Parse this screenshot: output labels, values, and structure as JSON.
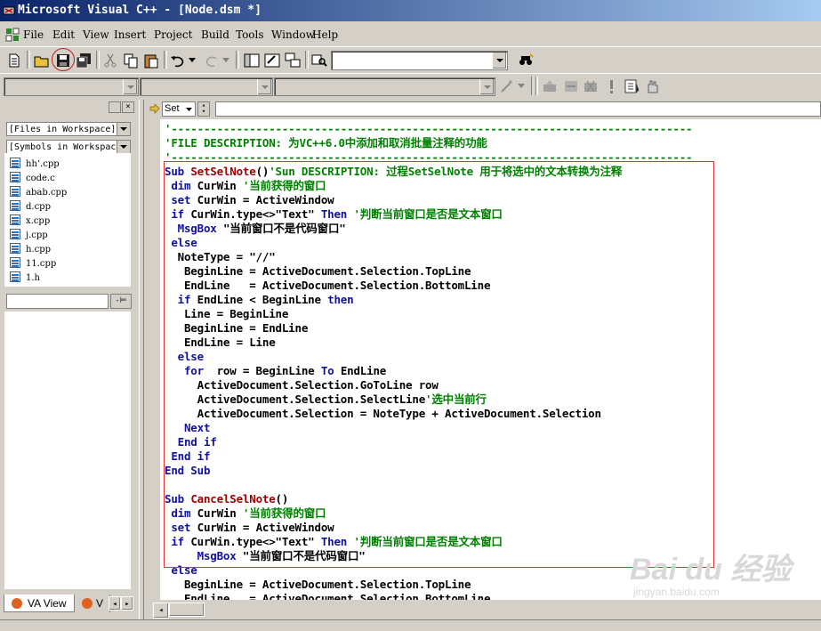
{
  "window": {
    "title": "Microsoft Visual C++ - [Node.dsm *]"
  },
  "menu": [
    "File",
    "Edit",
    "View",
    "Insert",
    "Project",
    "Build",
    "Tools",
    "Window",
    "Help"
  ],
  "toolbar": {
    "find_value": ""
  },
  "workspace": {
    "files_combo": "[Files in Workspace]",
    "symbols_combo": "[Symbols in Workspac",
    "files": [
      "hh‘.cpp",
      "code.c",
      "abab.cpp",
      "d.cpp",
      "x.cpp",
      "j.cpp",
      "h.cpp",
      "11.cpp",
      "1.h"
    ],
    "filter_value": "",
    "tabs": [
      "VA View",
      "V"
    ]
  },
  "editor": {
    "set_label": "Set",
    "lines": [
      [
        {
          "t": "'--------------------------------------------------------------------------------",
          "c": "cm"
        }
      ],
      [
        {
          "t": "'FILE DESCRIPTION: 为VC++6.0中添加和取消批量注释的功能",
          "c": "cm"
        }
      ],
      [
        {
          "t": "'--------------------------------------------------------------------------------",
          "c": "cm"
        }
      ],
      [
        {
          "t": "Sub ",
          "c": "kw"
        },
        {
          "t": "SetSelNote",
          "c": "rd"
        },
        {
          "t": "()",
          "c": ""
        },
        {
          "t": "'Sun DESCRIPTION: 过程SetSelNote 用于将选中的文本转换为注释",
          "c": "cm"
        }
      ],
      [
        {
          "t": " dim ",
          "c": "kw"
        },
        {
          "t": "CurWin ",
          "c": ""
        },
        {
          "t": "'当前获得的窗口",
          "c": "cm"
        }
      ],
      [
        {
          "t": " set ",
          "c": "kw"
        },
        {
          "t": "CurWin = ActiveWindow",
          "c": ""
        }
      ],
      [
        {
          "t": " if ",
          "c": "kw"
        },
        {
          "t": "CurWin.type<>\"Text\" ",
          "c": ""
        },
        {
          "t": "Then ",
          "c": "kw"
        },
        {
          "t": "'判断当前窗口是否是文本窗口",
          "c": "cm"
        }
      ],
      [
        {
          "t": "  MsgBox ",
          "c": "kw"
        },
        {
          "t": "\"当前窗口不是代码窗口\"",
          "c": ""
        }
      ],
      [
        {
          "t": " else",
          "c": "kw"
        }
      ],
      [
        {
          "t": "  NoteType = \"//\"",
          "c": ""
        }
      ],
      [
        {
          "t": "   BeginLine = ActiveDocument.Selection.TopLine",
          "c": ""
        }
      ],
      [
        {
          "t": "   EndLine   = ActiveDocument.Selection.BottomLine",
          "c": ""
        }
      ],
      [
        {
          "t": "  if ",
          "c": "kw"
        },
        {
          "t": "EndLine < BeginLine ",
          "c": ""
        },
        {
          "t": "then",
          "c": "kw"
        }
      ],
      [
        {
          "t": "   Line = BeginLine",
          "c": ""
        }
      ],
      [
        {
          "t": "   BeginLine = EndLine",
          "c": ""
        }
      ],
      [
        {
          "t": "   EndLine = Line",
          "c": ""
        }
      ],
      [
        {
          "t": "  else",
          "c": "kw"
        }
      ],
      [
        {
          "t": "   for ",
          "c": "kw"
        },
        {
          "t": " row = BeginLine ",
          "c": ""
        },
        {
          "t": "To ",
          "c": "kw"
        },
        {
          "t": "EndLine",
          "c": ""
        }
      ],
      [
        {
          "t": "     ActiveDocument.Selection.GoToLine row",
          "c": ""
        }
      ],
      [
        {
          "t": "     ActiveDocument.Selection.SelectLine",
          "c": ""
        },
        {
          "t": "'选中当前行",
          "c": "cm"
        }
      ],
      [
        {
          "t": "     ActiveDocument.Selection = NoteType + ActiveDocument.Selection",
          "c": ""
        }
      ],
      [
        {
          "t": "   Next",
          "c": "kw"
        }
      ],
      [
        {
          "t": "  End if",
          "c": "kw"
        }
      ],
      [
        {
          "t": " End if",
          "c": "kw"
        }
      ],
      [
        {
          "t": "End Sub",
          "c": "kw"
        }
      ],
      [
        {
          "t": "",
          "c": ""
        }
      ],
      [
        {
          "t": "Sub ",
          "c": "kw"
        },
        {
          "t": "CancelSelNote",
          "c": "rd"
        },
        {
          "t": "()",
          "c": ""
        }
      ],
      [
        {
          "t": " dim ",
          "c": "kw"
        },
        {
          "t": "CurWin ",
          "c": ""
        },
        {
          "t": "'当前获得的窗口",
          "c": "cm"
        }
      ],
      [
        {
          "t": " set ",
          "c": "kw"
        },
        {
          "t": "CurWin = ActiveWindow",
          "c": ""
        }
      ],
      [
        {
          "t": " if ",
          "c": "kw"
        },
        {
          "t": "CurWin.type<>\"Text\" ",
          "c": ""
        },
        {
          "t": "Then ",
          "c": "kw"
        },
        {
          "t": "'判断当前窗口是否是文本窗口",
          "c": "cm"
        }
      ],
      [
        {
          "t": "     MsgBox ",
          "c": "kw"
        },
        {
          "t": "\"当前窗口不是代码窗口\"",
          "c": ""
        }
      ],
      [
        {
          "t": " else",
          "c": "kw"
        }
      ],
      [
        {
          "t": "   BeginLine = ActiveDocument.Selection.TopLine",
          "c": ""
        }
      ],
      [
        {
          "t": "   EndLine   = ActiveDocument.Selection.BottomLine",
          "c": ""
        }
      ]
    ]
  },
  "watermark": {
    "brand": "Bai du 经验",
    "url": "jingyan.baidu.com"
  },
  "colors": {
    "keyword": "#1010a0",
    "comment": "#008000",
    "proc_name": "#a00000",
    "highlight_box": "#e03030"
  }
}
